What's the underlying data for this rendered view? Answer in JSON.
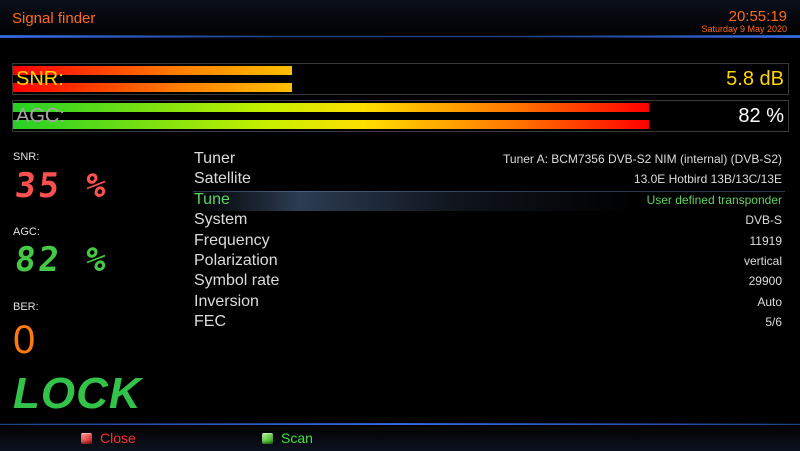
{
  "header": {
    "title": "Signal finder",
    "time": "20:55:19",
    "date": "Saturday  9 May 2020"
  },
  "bars": {
    "snr": {
      "label": "SNR:",
      "value_text": "5.8 dB",
      "fill_fraction": 0.36
    },
    "agc": {
      "label": "AGC:",
      "value_text": "82 %",
      "fill_fraction": 0.82
    }
  },
  "side": {
    "snr_label": "SNR:",
    "snr_value": "35 %",
    "agc_label": "AGC:",
    "agc_value": "82 %",
    "ber_label": "BER:",
    "ber_value": "0",
    "lock_text": "LOCK"
  },
  "info_rows": [
    {
      "key": "Tuner",
      "value": "Tuner A: BCM7356 DVB-S2 NIM (internal) (DVB-S2)"
    },
    {
      "key": "Satellite",
      "value": "13.0E Hotbird 13B/13C/13E"
    },
    {
      "key": "Tune",
      "value": "User defined transponder",
      "selected": true
    },
    {
      "key": "System",
      "value": "DVB-S"
    },
    {
      "key": "Frequency",
      "value": "11919"
    },
    {
      "key": "Polarization",
      "value": "vertical"
    },
    {
      "key": "Symbol rate",
      "value": "29900"
    },
    {
      "key": "Inversion",
      "value": "Auto"
    },
    {
      "key": "FEC",
      "value": "5/6"
    }
  ],
  "footer": {
    "close_label": "Close",
    "scan_label": "Scan"
  },
  "colors": {
    "accent_orange": "#ff6a1a",
    "snr_red": "#ff5050",
    "agc_green": "#45c845",
    "lock_green": "#33c24a",
    "selected_green": "#5fd35f"
  },
  "icons": {
    "close_key": "red-key-icon",
    "scan_key": "green-key-icon"
  }
}
